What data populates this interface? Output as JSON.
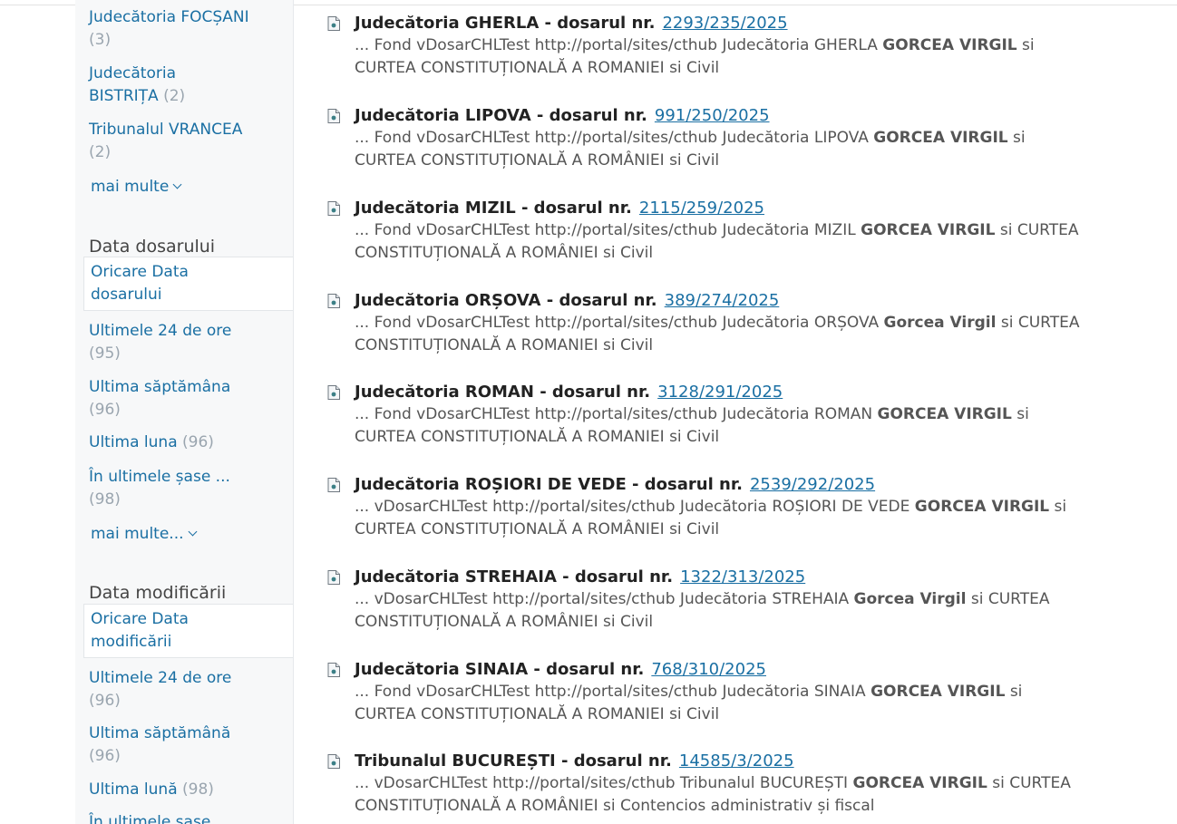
{
  "sidebar": {
    "court_filters": [
      {
        "line1": "Judecătoria FOCȘANI",
        "line2": "",
        "count": "(3)"
      },
      {
        "line1": "Judecătoria",
        "line2": "BISTRIȚA",
        "count": "(2)"
      },
      {
        "line1": "Tribunalul VRANCEA",
        "line2": "",
        "count": "(2)"
      }
    ],
    "court_more": "mai multe",
    "data_dosarului": {
      "heading": "Data dosarului",
      "any_line1": "Oricare Data",
      "any_line2": "dosarului",
      "options": [
        {
          "label": "Ultimele 24 de ore",
          "count": "(95)"
        },
        {
          "label": "Ultima săptămâna",
          "count": "(96)"
        },
        {
          "label": "Ultima luna",
          "count": "(96)"
        },
        {
          "label": "În ultimele șase ...",
          "count": "(98)"
        }
      ],
      "more": "mai multe..."
    },
    "data_modificarii": {
      "heading": "Data modificării",
      "any_line1": "Oricare Data",
      "any_line2": "modificării",
      "options": [
        {
          "label": "Ultimele 24 de ore",
          "count": "(96)"
        },
        {
          "label": "Ultima săptămână",
          "count": "(96)"
        },
        {
          "label": "Ultima lună",
          "count": "(98)"
        },
        {
          "label": "În ultimele șase",
          "count": ""
        }
      ]
    }
  },
  "results": [
    {
      "title": "Judecătoria GHERLA - dosarul nr.",
      "link": "2293/235/2025",
      "snippet": [
        [
          "... Fond vDosarCHLTest http://portal/sites/cthub Judecătoria GHERLA ",
          false
        ],
        [
          "GORCEA VIRGIL",
          true
        ],
        [
          " si CURTEA CONSTITUȚIONALĂ A ROMANIEI si Civil",
          false
        ]
      ]
    },
    {
      "title": "Judecătoria LIPOVA - dosarul nr.",
      "link": "991/250/2025",
      "snippet": [
        [
          "... Fond vDosarCHLTest http://portal/sites/cthub Judecătoria LIPOVA ",
          false
        ],
        [
          "GORCEA VIRGIL",
          true
        ],
        [
          " si CURTEA CONSTITUȚIONALĂ A ROMÂNIEI si Civil",
          false
        ]
      ]
    },
    {
      "title": "Judecătoria MIZIL - dosarul nr.",
      "link": "2115/259/2025",
      "snippet": [
        [
          "... Fond vDosarCHLTest http://portal/sites/cthub Judecătoria MIZIL ",
          false
        ],
        [
          "GORCEA VIRGIL",
          true
        ],
        [
          " si CURTEA CONSTITUȚIONALĂ A ROMÂNIEI si Civil",
          false
        ]
      ]
    },
    {
      "title": "Judecătoria ORȘOVA - dosarul nr.",
      "link": "389/274/2025",
      "snippet": [
        [
          "... Fond vDosarCHLTest http://portal/sites/cthub Judecătoria ORȘOVA ",
          false
        ],
        [
          "Gorcea Virgil",
          true
        ],
        [
          " si CURTEA CONSTITUȚIONALĂ A ROMANIEI si Civil",
          false
        ]
      ]
    },
    {
      "title": "Judecătoria ROMAN - dosarul nr.",
      "link": "3128/291/2025",
      "snippet": [
        [
          "... Fond vDosarCHLTest http://portal/sites/cthub Judecătoria ROMAN ",
          false
        ],
        [
          "GORCEA VIRGIL",
          true
        ],
        [
          " si CURTEA CONSTITUȚIONALĂ A ROMANIEI si Civil",
          false
        ]
      ]
    },
    {
      "title": "Judecătoria ROȘIORI DE VEDE - dosarul nr.",
      "link": "2539/292/2025",
      "snippet": [
        [
          "... vDosarCHLTest http://portal/sites/cthub Judecătoria ROȘIORI DE VEDE ",
          false
        ],
        [
          "GORCEA VIRGIL",
          true
        ],
        [
          " si CURTEA CONSTITUȚIONALĂ A ROMÂNIEI si Civil",
          false
        ]
      ]
    },
    {
      "title": "Judecătoria STREHAIA - dosarul nr.",
      "link": "1322/313/2025",
      "snippet": [
        [
          "... vDosarCHLTest http://portal/sites/cthub Judecătoria STREHAIA ",
          false
        ],
        [
          "Gorcea Virgil",
          true
        ],
        [
          " si CURTEA CONSTITUȚIONALĂ A ROMÂNIEI si Civil",
          false
        ]
      ]
    },
    {
      "title": "Judecătoria SINAIA - dosarul nr.",
      "link": "768/310/2025",
      "snippet": [
        [
          "... Fond vDosarCHLTest http://portal/sites/cthub Judecătoria SINAIA ",
          false
        ],
        [
          "GORCEA VIRGIL",
          true
        ],
        [
          " si CURTEA CONSTITUȚIONALĂ A ROMANIEI si Civil",
          false
        ]
      ]
    },
    {
      "title": "Tribunalul BUCUREȘTI - dosarul nr.",
      "link": "14585/3/2025",
      "snippet": [
        [
          "... vDosarCHLTest http://portal/sites/cthub Tribunalul BUCUREȘTI ",
          false
        ],
        [
          "GORCEA VIRGIL",
          true
        ],
        [
          " si CURTEA CONSTITUȚIONALĂ A ROMÂNIEI si Contencios administrativ și fiscal",
          false
        ]
      ]
    }
  ]
}
